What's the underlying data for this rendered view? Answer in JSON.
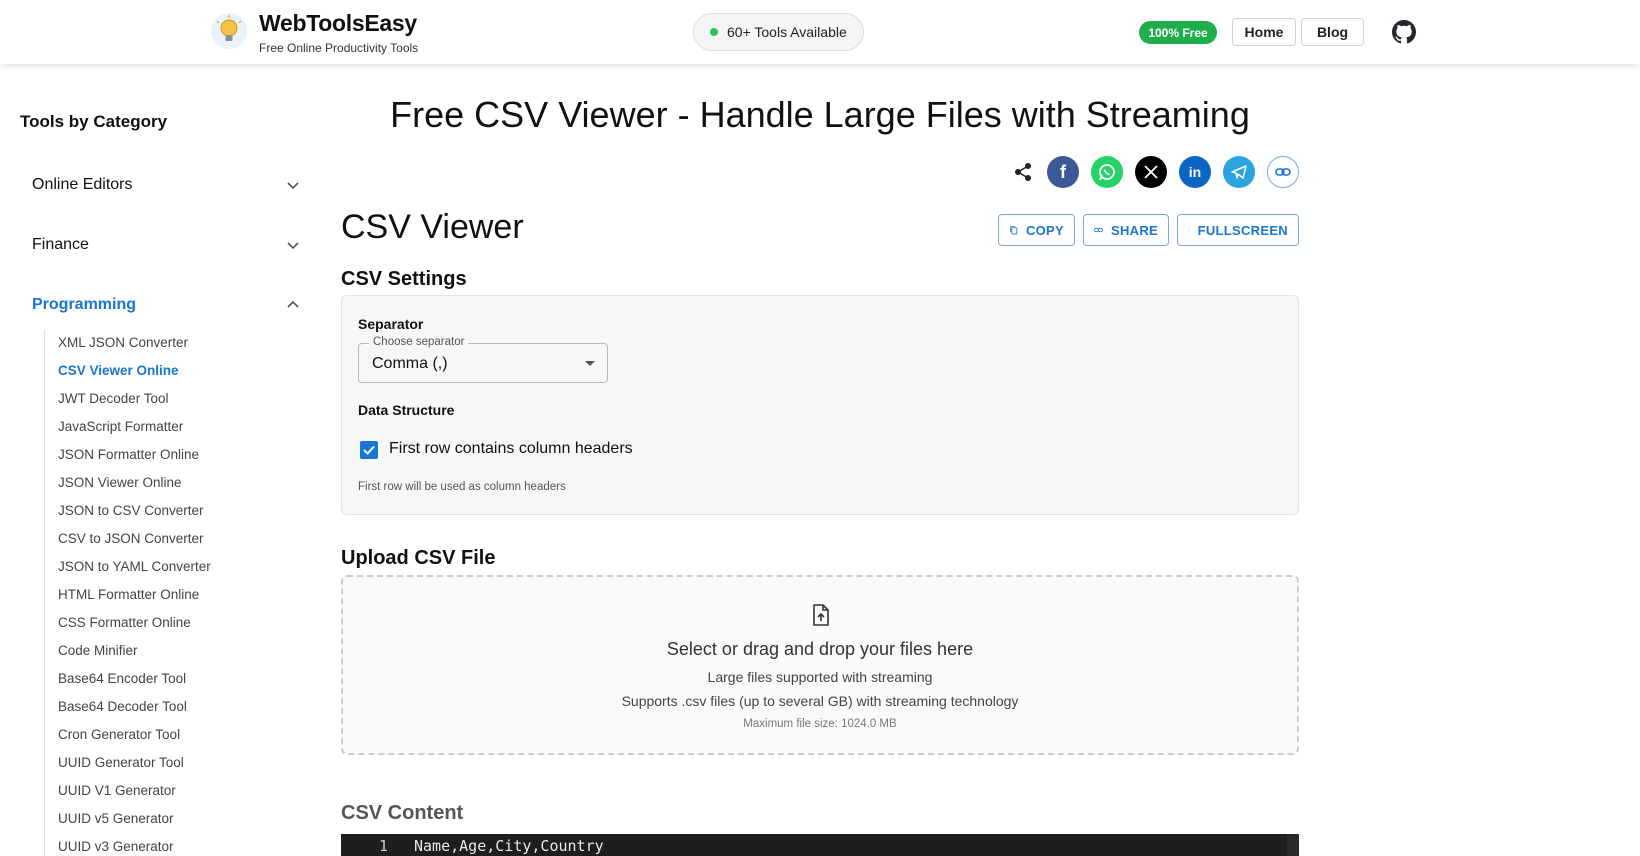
{
  "header": {
    "brand_name": "WebToolsEasy",
    "brand_tagline": "Free Online Productivity Tools",
    "tools_available": "60+ Tools Available",
    "free_badge": "100% Free",
    "nav": {
      "home": "Home",
      "blog": "Blog"
    }
  },
  "sidebar": {
    "title": "Tools by Category",
    "categories": [
      {
        "label": "Online Editors",
        "expanded": false
      },
      {
        "label": "Finance",
        "expanded": false
      },
      {
        "label": "Programming",
        "expanded": true
      }
    ],
    "programming_items": [
      "XML JSON Converter",
      "CSV Viewer Online",
      "JWT Decoder Tool",
      "JavaScript Formatter",
      "JSON Formatter Online",
      "JSON Viewer Online",
      "JSON to CSV Converter",
      "CSV to JSON Converter",
      "JSON to YAML Converter",
      "HTML Formatter Online",
      "CSS Formatter Online",
      "Code Minifier",
      "Base64 Encoder Tool",
      "Base64 Decoder Tool",
      "Cron Generator Tool",
      "UUID Generator Tool",
      "UUID V1 Generator",
      "UUID v5 Generator",
      "UUID v3 Generator"
    ],
    "active_item": "CSV Viewer Online"
  },
  "main": {
    "page_title": "Free CSV Viewer - Handle Large Files with Streaming",
    "share_icons": [
      "share-icon",
      "facebook-icon",
      "whatsapp-icon",
      "x-icon",
      "linkedin-icon",
      "telegram-icon",
      "link-icon"
    ],
    "tool_title": "CSV Viewer",
    "actions": {
      "copy": "COPY",
      "share": "SHARE",
      "fullscreen": "FULLSCREEN"
    },
    "settings": {
      "heading": "CSV Settings",
      "separator_label": "Separator",
      "separator_legend": "Choose separator",
      "separator_value": "Comma (,)",
      "structure_label": "Data Structure",
      "header_checkbox_label": "First row contains column headers",
      "header_checked": true,
      "helper": "First row will be used as column headers"
    },
    "upload": {
      "heading": "Upload CSV File",
      "main": "Select or drag and drop your files here",
      "line2": "Large files supported with streaming",
      "line3": "Supports .csv files (up to several GB) with streaming technology",
      "line4": "Maximum file size: 1024.0 MB"
    },
    "content": {
      "heading": "CSV Content",
      "line_number": "1",
      "line_text": "Name,Age,City,Country"
    }
  },
  "colors": {
    "accent": "#1976d2",
    "free_badge": "#1fae4b",
    "facebook": "#3b5998",
    "whatsapp": "#25d366",
    "x": "#000000",
    "linkedin": "#0a66c2",
    "telegram": "#2aa3e0",
    "editor_bg": "#1e1e1e"
  }
}
